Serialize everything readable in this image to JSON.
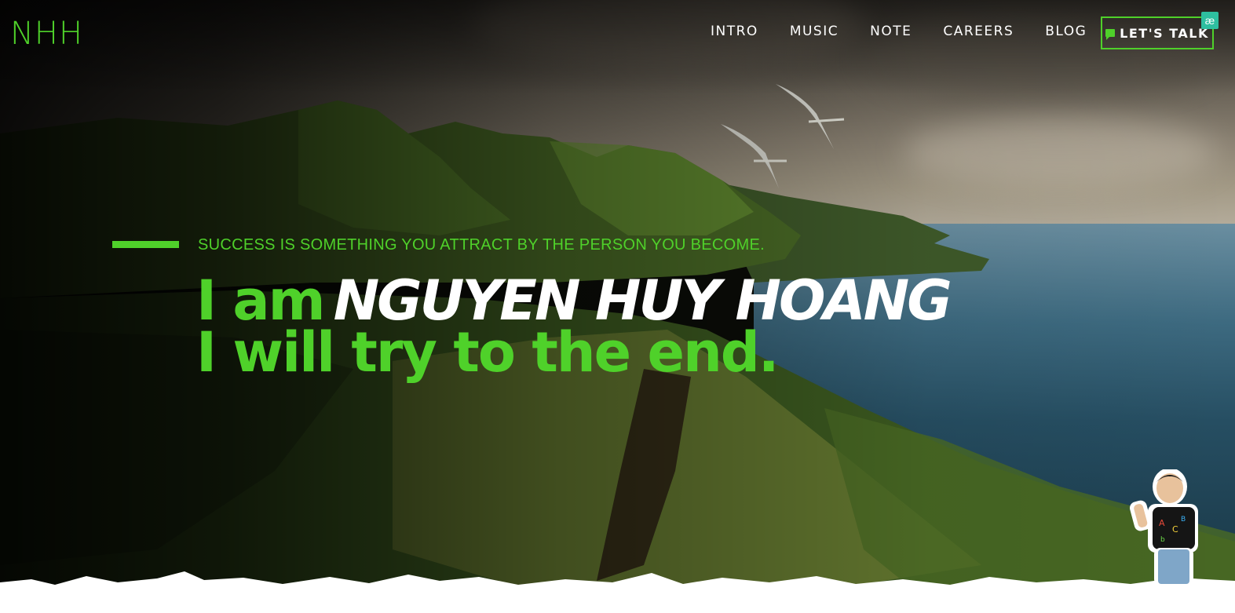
{
  "brand": {
    "logo": "NHH"
  },
  "nav": {
    "items": [
      {
        "label": "INTRO"
      },
      {
        "label": "MUSIC"
      },
      {
        "label": "NOTE"
      },
      {
        "label": "CAREERS"
      },
      {
        "label": "BLOG"
      }
    ],
    "cta": {
      "label": "LET'S TALK",
      "icon": "chat-icon"
    }
  },
  "badge": {
    "text": "æ"
  },
  "hero": {
    "tagline": "SUCCESS IS SOMETHING YOU ATTRACT BY THE PERSON YOU BECOME.",
    "intro": "I am",
    "name": "NGUYEN HUY HOANG",
    "motto": "I will try to the end."
  },
  "colors": {
    "accent": "#4fd12a",
    "text": "#ffffff"
  }
}
